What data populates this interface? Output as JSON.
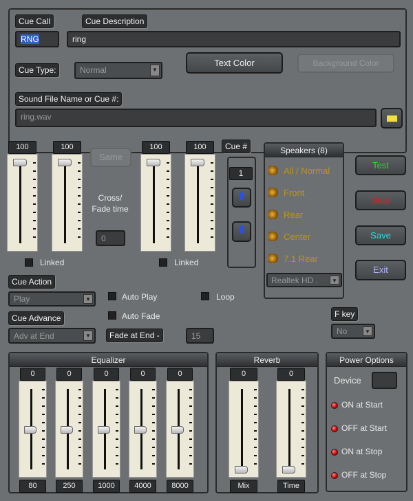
{
  "cue": {
    "call_label": "Cue Call",
    "call_value": "RNG",
    "desc_label": "Cue Description",
    "desc_value": "ring",
    "type_label": "Cue Type:",
    "type_value": "Normal",
    "text_color": "Text Color",
    "bg_color": "Background Color",
    "sound_label": "Sound File Name or Cue #:",
    "sound_value": "ring.wav"
  },
  "volume": {
    "sliders": [
      {
        "value": "100",
        "level": 1
      },
      {
        "value": "100",
        "level": 1
      },
      {
        "value": "100",
        "level": 1
      },
      {
        "value": "100",
        "level": 1
      }
    ],
    "same": "Same",
    "crossfade_label": "Cross/ Fade time",
    "crossfade_value": "0",
    "linked": "Linked",
    "linked2": "Linked"
  },
  "cuenum": {
    "label": "Cue #",
    "value": "1"
  },
  "speakers": {
    "title": "Speakers (8)",
    "items": [
      "All / Normal",
      "Front",
      "Rear",
      "Center",
      "7.1 Rear"
    ],
    "device": "Realtek HD ."
  },
  "actions": {
    "test": "Test",
    "stop": "Stop",
    "save": "Save",
    "exit": "Exit"
  },
  "options": {
    "cue_action_label": "Cue Action",
    "cue_action": "Play",
    "auto_play": "Auto Play",
    "loop": "Loop",
    "auto_fade": "Auto Fade",
    "cue_advance_label": "Cue Advance",
    "cue_advance": "Adv at End",
    "fade_end_label": "Fade at End -",
    "fade_end_value": "15",
    "fkey_label": "F key",
    "fkey_value": "No"
  },
  "equalizer": {
    "title": "Equalizer",
    "bands": [
      {
        "value": "0",
        "label": "80",
        "level": 0.5
      },
      {
        "value": "0",
        "label": "250",
        "level": 0.5
      },
      {
        "value": "0",
        "label": "1000",
        "level": 0.5
      },
      {
        "value": "0",
        "label": "4000",
        "level": 0.5
      },
      {
        "value": "0",
        "label": "8000",
        "level": 0.5
      }
    ]
  },
  "reverb": {
    "title": "Reverb",
    "sliders": [
      {
        "value": "0",
        "label": "Mix",
        "level": 0
      },
      {
        "value": "0",
        "label": "Time",
        "level": 0
      }
    ]
  },
  "power": {
    "title": "Power Options",
    "device_label": "Device",
    "items": [
      "ON at Start",
      "OFF at Start",
      "ON at Stop",
      "OFF at Stop"
    ]
  },
  "colors": {
    "test": "#22dd22",
    "stop": "#dd2222",
    "save": "#22dddd",
    "exit": "#b0b0ff"
  }
}
